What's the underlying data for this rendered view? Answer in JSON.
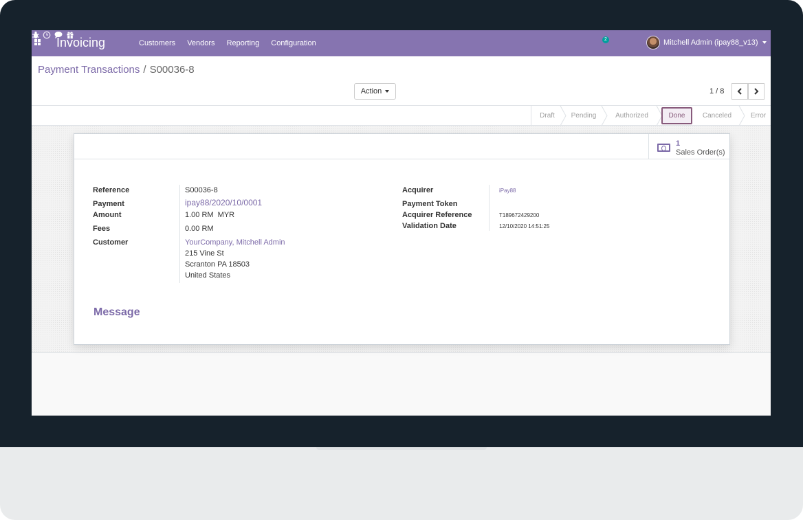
{
  "navbar": {
    "app_name": "Invoicing",
    "menu": [
      "Customers",
      "Vendors",
      "Reporting",
      "Configuration"
    ],
    "chat_count": "2",
    "user_name": "Mitchell Admin (ipay88_v13)",
    "icons": [
      "bug-icon",
      "clock-icon",
      "chat-icon",
      "gift-icon"
    ]
  },
  "breadcrumb": {
    "parent": "Payment Transactions",
    "separator": "/",
    "current": "S00036-8"
  },
  "toolbar": {
    "action_label": "Action",
    "pager": "1 / 8"
  },
  "status_stages": [
    {
      "label": "Draft",
      "active": false
    },
    {
      "label": "Pending",
      "active": false
    },
    {
      "label": "Authorized",
      "active": false
    },
    {
      "label": "Done",
      "active": true
    },
    {
      "label": "Canceled",
      "active": false
    },
    {
      "label": "Error",
      "active": false
    }
  ],
  "smart_button": {
    "count": "1",
    "label": "Sales Order(s)"
  },
  "form": {
    "left": {
      "reference_label": "Reference",
      "reference_value": "S00036-8",
      "payment_label": "Payment",
      "payment_value": "ipay88/2020/10/0001",
      "amount_label": "Amount",
      "amount_value": "1.00 RM  MYR",
      "fees_label": "Fees",
      "fees_value": "0.00 RM",
      "customer_label": "Customer",
      "customer_name": "YourCompany, Mitchell Admin",
      "customer_street": "215 Vine St",
      "customer_city": "Scranton PA 18503",
      "customer_country": "United States"
    },
    "right": {
      "acquirer_label": "Acquirer",
      "acquirer_value": "iPay88",
      "token_label": "Payment Token",
      "acq_ref_label": "Acquirer Reference",
      "acq_ref_value": "T189672429200",
      "validation_label": "Validation Date",
      "validation_value": "12/10/2020 14:51:25"
    }
  },
  "message_heading": "Message",
  "colors": {
    "navbar": "#8674b0",
    "accent": "#7c6aa8",
    "done": "#875a7b",
    "bezel": "#16222c"
  }
}
